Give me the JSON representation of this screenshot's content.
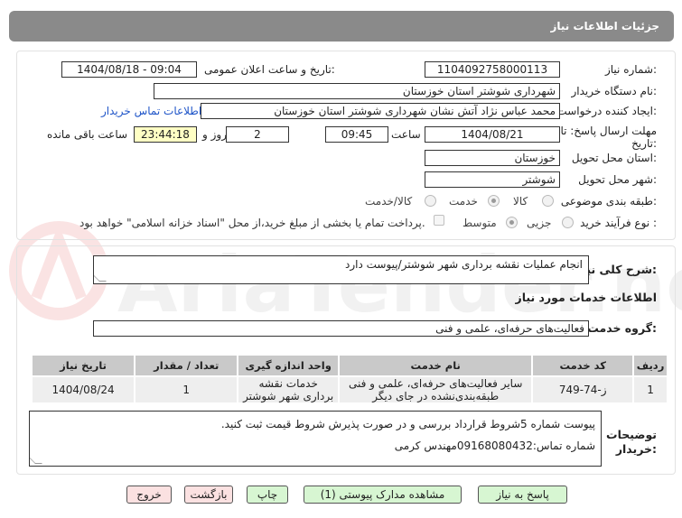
{
  "title": "جزئیات اطلاعات نیاز",
  "fields": {
    "need_number_label": "شماره نیاز:",
    "need_number": "1104092758000113",
    "announce_label": "تاریخ و ساعت اعلان عمومی:",
    "announce_value": "1404/08/18 - 09:04",
    "buyer_org_label": "نام دستگاه خریدار:",
    "buyer_org": "شهرداری شوشتر استان خوزستان",
    "creator_label": "ایجاد کننده درخواست:",
    "creator": "محمد عباس نژاد آتش نشان شهرداری شوشتر استان خوزستان",
    "contact_link": "اطلاعات تماس خریدار",
    "deadline_label": "مهلت ارسال پاسخ: تا تاریخ:",
    "deadline_date": "1404/08/21",
    "time_label": "ساعت",
    "deadline_time": "09:45",
    "days_value": "2",
    "days_label": "روز و",
    "remaining_time": "23:44:18",
    "remaining_label": "ساعت باقی مانده",
    "province_label": "استان محل تحویل:",
    "province": "خوزستان",
    "city_label": "شهر محل تحویل:",
    "city": "شوشتر",
    "category_label": "طبقه بندی موضوعی:",
    "category_options": [
      "کالا",
      "خدمت",
      "کالا/خدمت"
    ],
    "process_label": "نوع فرآیند خرید :",
    "process_options": [
      "جزیی",
      "متوسط"
    ],
    "payment_note": "پرداخت تمام یا بخشی از مبلغ خرید،از محل \"اسناد خزانه اسلامی\" خواهد بود."
  },
  "description": {
    "label": "شرح کلی نیاز:",
    "value": "انجام عملیات نقشه برداری شهر شوشتر/پیوست دارد"
  },
  "services": {
    "heading": "اطلاعات خدمات مورد نیاز",
    "group_label": "گروه خدمت:",
    "group_value": "فعالیت‌های حرفه‌ای، علمی و فنی",
    "columns": [
      "ردیف",
      "کد خدمت",
      "نام خدمت",
      "واحد اندازه گیری",
      "تعداد / مقدار",
      "تاریخ نیاز"
    ],
    "rows": [
      [
        "1",
        "ز-74-749",
        "سایر فعالیت‌های حرفه‌ای، علمی و فنی طبقه‌بندی‌نشده در جای دیگر",
        "خدمات نقشه برداری شهر شوشتر",
        "1",
        "1404/08/24"
      ]
    ]
  },
  "buyer_notes": {
    "label": "توضیحات خریدار:",
    "line1": "پیوست شماره 5شروط قرارداد بررسی و در صورت پذیرش شروط قیمت ثبت کنید.",
    "line2": "شماره تماس:09168080432مهندس کرمی"
  },
  "buttons": {
    "reply": "پاسخ به نیاز",
    "attachments": "مشاهده مدارک پیوستی (1)",
    "print": "چاپ",
    "back": "بازگشت",
    "exit": "خروج"
  },
  "watermark": "AriaTender.net",
  "colors": {
    "titlebar": "#8a8a8a",
    "link": "#1f55c8",
    "highlight": "#ffffc4",
    "table_header": "#c9c9c9"
  }
}
